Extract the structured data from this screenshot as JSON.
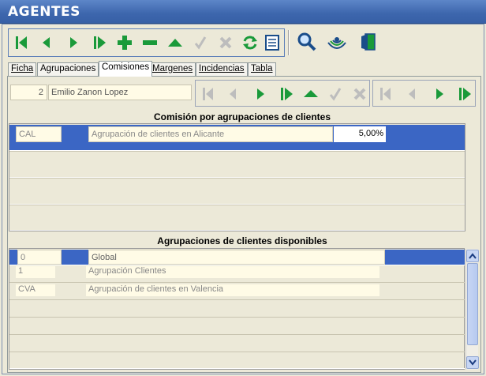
{
  "window": {
    "title": "AGENTES"
  },
  "toolbar": {
    "buttons": [
      {
        "name": "first-record-icon",
        "color": "#1a9a3a"
      },
      {
        "name": "previous-record-icon",
        "color": "#1a9a3a"
      },
      {
        "name": "next-record-icon",
        "color": "#1a9a3a"
      },
      {
        "name": "last-record-icon",
        "color": "#1a9a3a"
      },
      {
        "name": "add-record-icon",
        "color": "#1a9a3a"
      },
      {
        "name": "delete-record-icon",
        "color": "#1a9a3a"
      },
      {
        "name": "edit-record-icon",
        "color": "#1a9a3a"
      },
      {
        "name": "confirm-check-icon",
        "color": "#bdbdbd"
      },
      {
        "name": "cancel-x-icon",
        "color": "#bdbdbd"
      },
      {
        "name": "refresh-icon",
        "color": "#1a9a3a"
      },
      {
        "name": "report-list-icon",
        "color": "#1a4d8a"
      }
    ],
    "extra": [
      {
        "name": "search-icon",
        "color": "#1a4d8a"
      },
      {
        "name": "broadcast-icon",
        "color": "#1a4d8a"
      },
      {
        "name": "exit-door-icon",
        "color": "#1a4d8a"
      }
    ]
  },
  "tabs": [
    {
      "label": "Ficha",
      "active": false
    },
    {
      "label": "Agrupaciones",
      "active": false
    },
    {
      "label": "Comisiones",
      "active": true
    },
    {
      "label": "Margenes",
      "active": false
    },
    {
      "label": "Incidencias",
      "active": false
    },
    {
      "label": "Tabla",
      "active": false
    }
  ],
  "agent": {
    "number": "2",
    "name": "Emilio Zanon Lopez"
  },
  "commissions": {
    "title": "Comisión por agrupaciones de clientes",
    "rows": [
      {
        "code": "CAL",
        "description": "Agrupación de clientes en Alicante",
        "percent": "5,00%",
        "selected": true
      }
    ]
  },
  "available": {
    "title": "Agrupaciones de clientes disponibles",
    "rows": [
      {
        "code": "0",
        "description": "Global",
        "selected": true
      },
      {
        "code": "1",
        "description": "Agrupación Clientes",
        "selected": false
      },
      {
        "code": "CVA",
        "description": "Agrupación  de clientes en Valencia",
        "selected": false
      }
    ]
  },
  "colors": {
    "titlebar": "#3d66ad",
    "selection": "#3b66c4",
    "field": "#fffbe6",
    "green": "#1a9a3a"
  }
}
